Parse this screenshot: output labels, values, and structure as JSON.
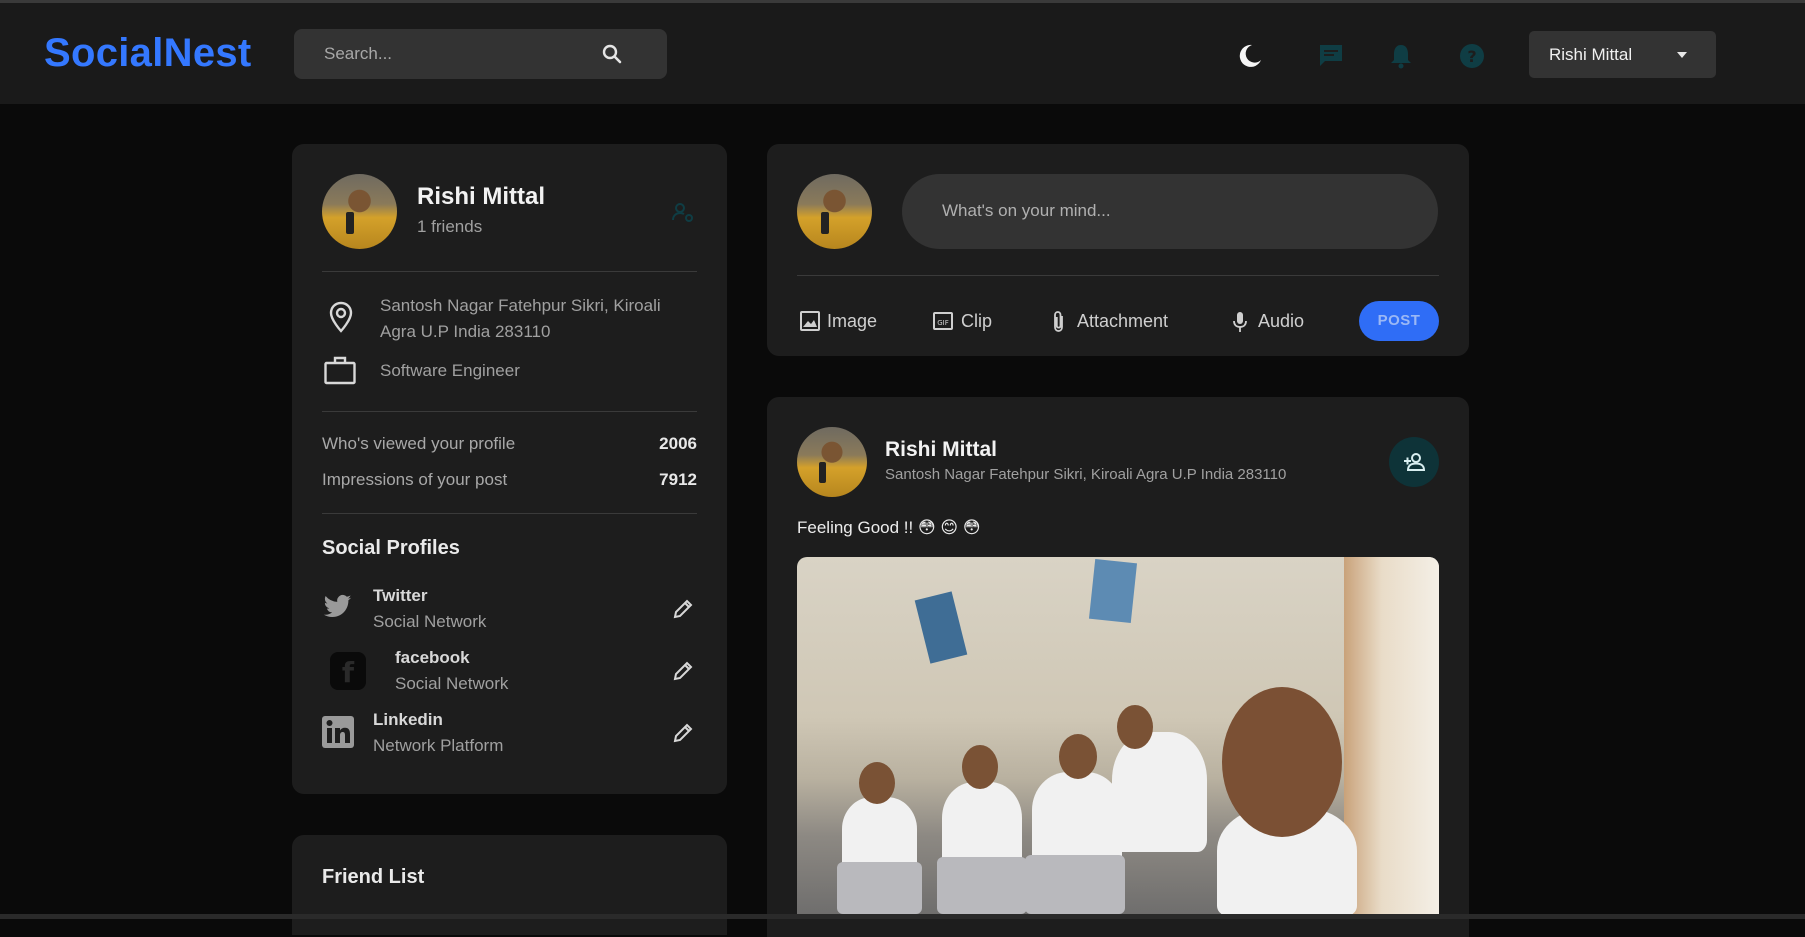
{
  "app": {
    "name": "SocialNest"
  },
  "colors": {
    "brand": "#3478ff",
    "post_button": "#2f6df6",
    "accent_teal": "#0e3338"
  },
  "search": {
    "placeholder": "Search..."
  },
  "navbar": {
    "icons": [
      "search-icon",
      "dark-mode-icon",
      "message-icon",
      "notification-bell-icon",
      "help-icon",
      "caret-down-icon"
    ],
    "user_select": {
      "selected": "Rishi Mittal"
    }
  },
  "profile": {
    "name": "Rishi Mittal",
    "friends": "1 friends",
    "location": "Santosh Nagar Fatehpur Sikri, Kiroali Agra U.P India 283110",
    "occupation": "Software Engineer",
    "stats": [
      {
        "label": "Who's viewed your profile",
        "value": "2006"
      },
      {
        "label": "Impressions of your post",
        "value": "7912"
      }
    ],
    "social_title": "Social Profiles",
    "social": [
      {
        "name": "Twitter",
        "sub": "Social Network",
        "icon": "twitter-icon"
      },
      {
        "name": "facebook",
        "sub": "Social Network",
        "icon": "facebook-icon"
      },
      {
        "name": "Linkedin",
        "sub": "Network Platform",
        "icon": "linkedin-icon"
      }
    ]
  },
  "friend_list": {
    "title": "Friend List"
  },
  "composer": {
    "placeholder": "What's on your mind...",
    "actions": [
      {
        "label": "Image",
        "icon": "image-icon"
      },
      {
        "label": "Clip",
        "icon": "gif-icon"
      },
      {
        "label": "Attachment",
        "icon": "attachment-icon"
      },
      {
        "label": "Audio",
        "icon": "microphone-icon"
      }
    ],
    "post_label": "POST"
  },
  "feed": {
    "post": {
      "author": "Rishi Mittal",
      "location": "Santosh Nagar Fatehpur Sikri, Kiroali Agra U.P India 283110",
      "text": "Feeling Good !! 😳 😊 😳"
    }
  }
}
